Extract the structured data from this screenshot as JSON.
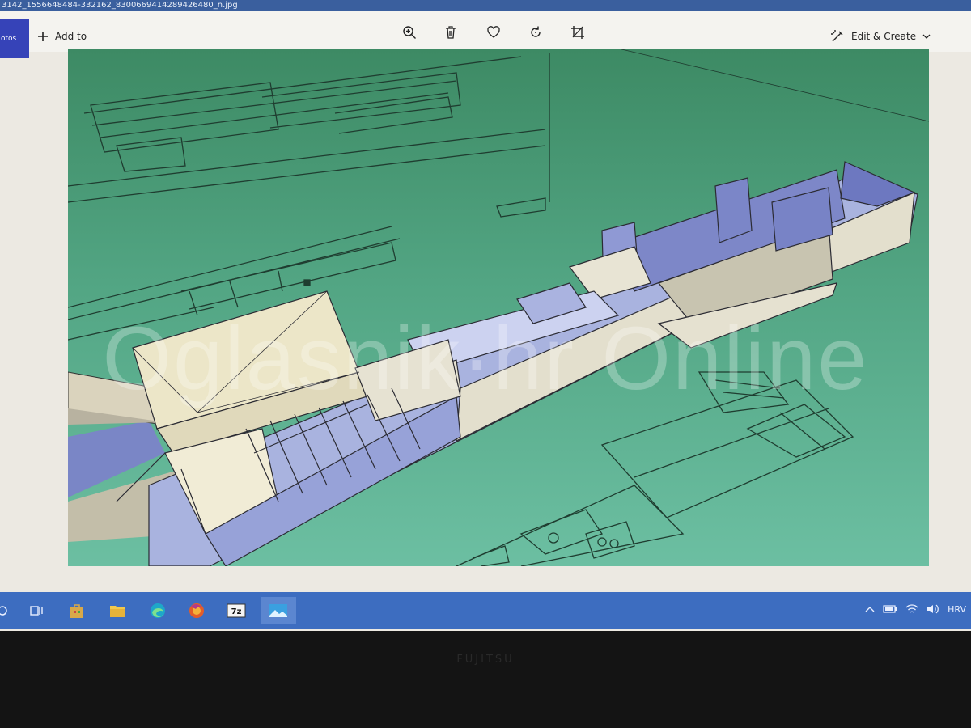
{
  "window": {
    "title": "3142_1556648484-332162_8300669414289426480_n.jpg"
  },
  "toolbar": {
    "photos_label": "otos",
    "add_to_label": "Add to",
    "edit_create_label": "Edit & Create",
    "icons": [
      "zoom-in-icon",
      "delete-icon",
      "heart-icon",
      "rotate-icon",
      "crop-icon"
    ]
  },
  "image": {
    "watermark_text": "Oglasnik·hr Online"
  },
  "taskbar": {
    "apps": [
      "start-icon",
      "task-view-icon",
      "store-icon",
      "file-explorer-icon",
      "edge-icon",
      "firefox-icon",
      "7zip-icon",
      "photos-icon"
    ],
    "tray_language": "HRV"
  },
  "bezel": {
    "brand": "FUJITSU"
  },
  "colors": {
    "taskbar": "#3d6dc0",
    "photos_accent": "#3643b8",
    "viewport_green": "#52a583",
    "model_blue": "#8d97d6"
  }
}
